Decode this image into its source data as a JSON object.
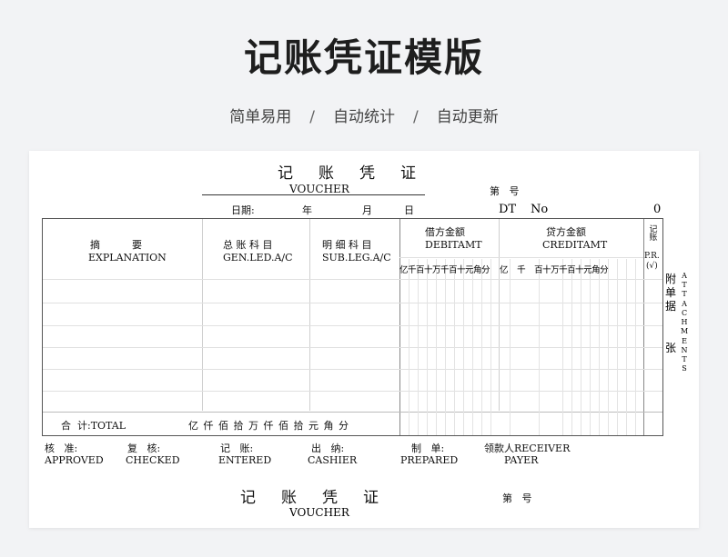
{
  "header": {
    "title": "记账凭证模版",
    "features": [
      "简单易用",
      "自动统计",
      "自动更新"
    ],
    "separator": "/"
  },
  "voucher": {
    "title_cn": "记账凭证",
    "title_en": "VOUCHER",
    "number_label": "第   号",
    "date_label": "日期:",
    "year": "年",
    "month": "月",
    "day": "日",
    "dt_label": "DT",
    "no_label": "No",
    "no_value": "0",
    "columns": {
      "explanation_cn": "摘          要",
      "explanation_en": "EXPLANATION",
      "gen_led_cn": "总 账 科 目",
      "gen_led_en": "GEN.LED.A/C",
      "sub_led_cn": "明 细 科 目",
      "sub_led_en": "SUB.LEG.A/C",
      "debit_cn": "借方金额",
      "debit_en": "DEBITAMT",
      "credit_cn": "贷方金额",
      "credit_en": "CREDITAMT",
      "pr_cn": "记账",
      "pr_en": "P.R.",
      "pr_check": "(√)",
      "debit_digits": "亿千百十万千百十元角分",
      "credit_digits": "亿    千    百十万千百十元角分"
    },
    "total_label": "合  计:TOTAL",
    "total_units": "亿 仟 佰 拾 万 仟 佰 拾 元 角 分",
    "attach_cn_1": "附单据",
    "attach_cn_2": "张",
    "attach_en": "ATTACHMENTS",
    "signatures": [
      {
        "cn": "核   准:",
        "en": "APPROVED"
      },
      {
        "cn": "复   核:",
        "en": "CHECKED"
      },
      {
        "cn": "记   账:",
        "en": "ENTERED"
      },
      {
        "cn": "出   纳:",
        "en": "CASHIER"
      },
      {
        "cn": "制   单:",
        "en": "PREPARED"
      },
      {
        "cn": "领款人RECEIVER",
        "en": "PAYER"
      }
    ]
  },
  "voucher2": {
    "title_cn": "记账凭证",
    "title_en": "VOUCHER",
    "number_label": "第   号"
  }
}
